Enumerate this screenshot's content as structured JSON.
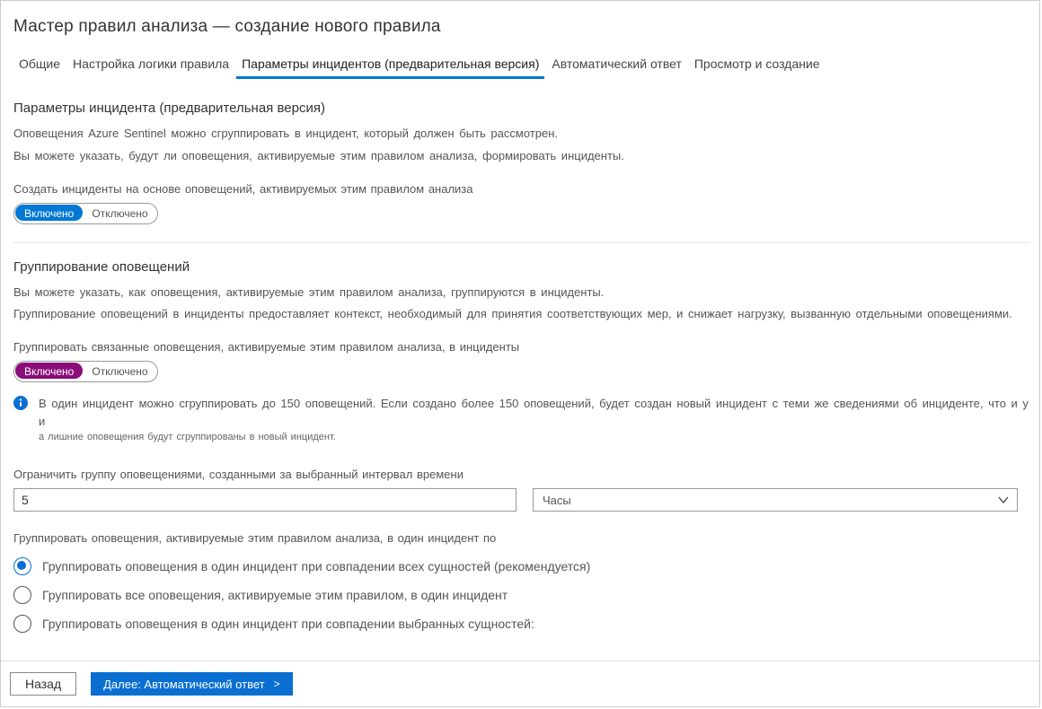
{
  "header": {
    "title": "Мастер правил анализа —   создание нового правила"
  },
  "tabs": [
    {
      "label": "Общие",
      "active": false
    },
    {
      "label": "Настройка логики правила",
      "active": false
    },
    {
      "label": "Параметры инцидентов (предварительная версия)",
      "active": true
    },
    {
      "label": "Автоматический ответ",
      "active": false
    },
    {
      "label": "Просмотр и создание",
      "active": false
    }
  ],
  "incident_settings": {
    "title": "Параметры инцидента (предварительная версия)",
    "desc1": "Оповещения Azure Sentinel можно сгруппировать в инцидент, который должен быть рассмотрен.",
    "desc2": "Вы можете указать, будут ли оповещения, активируемые этим правилом анализа, формировать инциденты.",
    "create_label": "Создать инциденты на основе оповещений, активируемых этим правилом анализа",
    "toggle": {
      "on": "Включено",
      "off": "Отключено"
    }
  },
  "grouping": {
    "title": "Группирование оповещений",
    "desc1": "Вы можете указать, как оповещения, активируемые этим правилом анализа, группируются в инциденты.",
    "desc2": "Группирование оповещений в инциденты предоставляет контекст, необходимый для принятия соответствующих мер, и снижает нагрузку, вызванную отдельными оповещениями.",
    "group_label": "Группировать связанные оповещения, активируемые этим правилом анализа, в инциденты",
    "toggle": {
      "on": "Включено",
      "off": "Отключено"
    },
    "info_main": "В один инцидент можно сгруппировать до 150 оповещений. Если создано более 150 оповещений, будет создан новый инцидент с теми же сведениями об инциденте, что и у и",
    "info_sub": "а лишние оповещения будут сгруппированы в новый инцидент.",
    "time_label": "Ограничить группу оповещениями, созданными за выбранный интервал времени",
    "time_value": "5",
    "time_unit": "Часы",
    "group_by_label": "Группировать оповещения, активируемые этим правилом анализа, в один инцидент по",
    "radios": [
      "Группировать оповещения в один инцидент при совпадении всех сущностей (рекомендуется)",
      "Группировать все оповещения, активируемые этим правилом, в один инцидент",
      "Группировать оповещения в один инцидент при совпадении выбранных сущностей:"
    ]
  },
  "footer": {
    "back": "Назад",
    "next": "Далее: Автоматический ответ"
  }
}
